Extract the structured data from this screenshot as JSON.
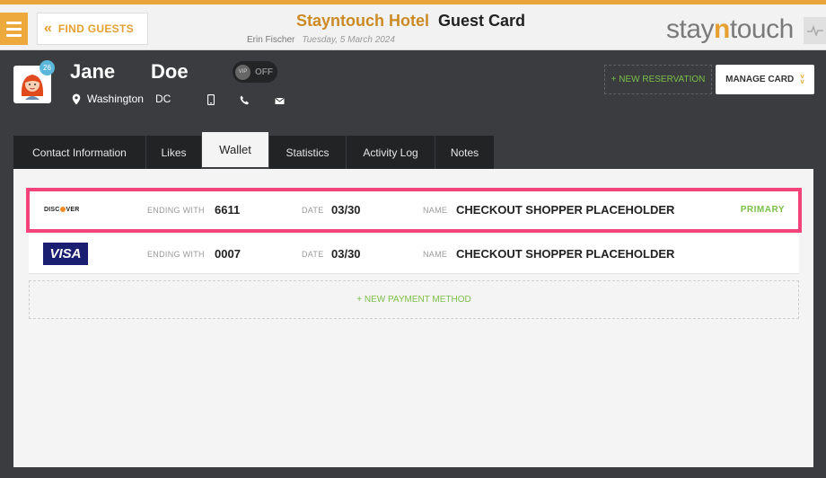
{
  "topbar": {
    "find_guests_label": "FIND GUESTS",
    "hotel_name": "Stayntouch Hotel",
    "page_title": "Guest Card",
    "user_name": "Erin Fischer",
    "date": "Tuesday, 5 March 2024",
    "logo_prefix": "stay",
    "logo_accent": "n",
    "logo_suffix": "touch"
  },
  "guest": {
    "first_name": "Jane",
    "last_name": "Doe",
    "badge_count": "26",
    "vip_label": "VIP",
    "vip_state": "OFF",
    "city": "Washington",
    "state": "DC"
  },
  "actions": {
    "new_reservation": "+ NEW RESERVATION",
    "manage_card": "MANAGE CARD"
  },
  "tabs": [
    {
      "label": "Contact Information"
    },
    {
      "label": "Likes"
    },
    {
      "label": "Wallet"
    },
    {
      "label": "Statistics"
    },
    {
      "label": "Activity Log"
    },
    {
      "label": "Notes"
    }
  ],
  "wallet": {
    "ending_label": "ENDING WITH",
    "date_label": "DATE",
    "name_label": "NAME",
    "primary_label": "PRIMARY",
    "cards": [
      {
        "brand": "DISCOVER",
        "ending": "6611",
        "date": "03/30",
        "name": "CHECKOUT SHOPPER PLACEHOLDER"
      },
      {
        "brand": "VISA",
        "ending": "0007",
        "date": "03/30",
        "name": "CHECKOUT SHOPPER PLACEHOLDER"
      }
    ],
    "new_payment": "+ NEW PAYMENT METHOD"
  },
  "colors": {
    "accent": "#e5a031",
    "highlight": "#f2447a",
    "positive": "#7cbf4a",
    "visa_blue": "#1a1f71"
  }
}
